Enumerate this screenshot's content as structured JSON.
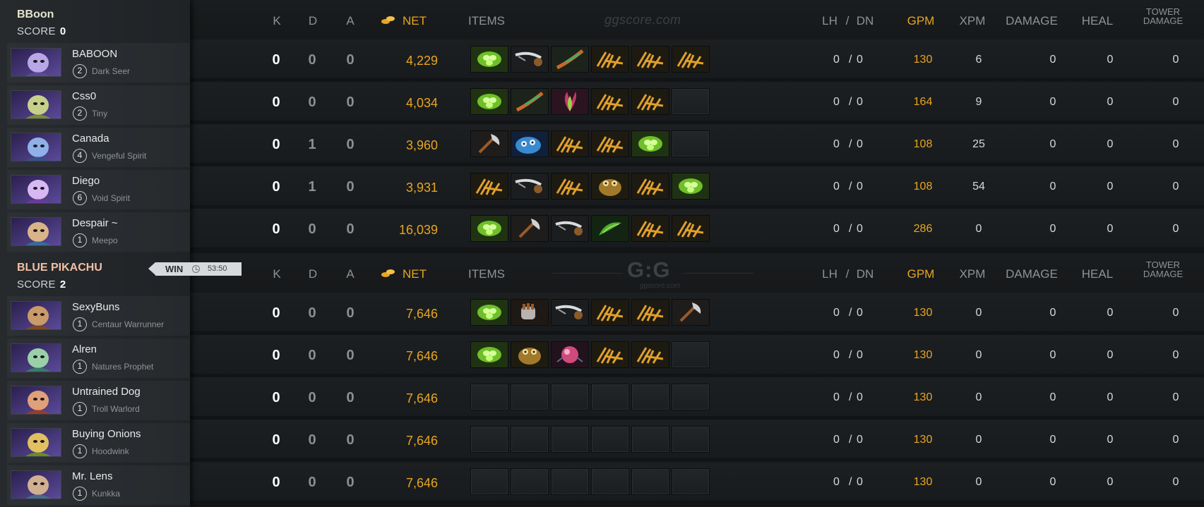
{
  "teams": [
    {
      "name": "BBoon",
      "name_color": "#e5e3cc",
      "score_label": "SCORE",
      "score": "0",
      "header": {
        "k": "K",
        "d": "D",
        "a": "A",
        "net": "NET",
        "items": "ITEMS",
        "lh": "LH",
        "slash": "/",
        "dn": "DN",
        "gpm": "GPM",
        "xpm": "XPM",
        "damage": "DAMAGE",
        "heal": "HEAL",
        "tower_line1": "TOWER",
        "tower_line2": "DAMAGE",
        "watermark": "ggscore.com"
      },
      "players": [
        {
          "name": "BABOON",
          "level": "2",
          "hero": "Dark Seer",
          "portrait": [
            "#5b4a9a",
            "#b9a6e6",
            "#2b1f4d"
          ],
          "k": "0",
          "d": "0",
          "a": "0",
          "net": "4,229",
          "items": [
            "leaf-item-icon",
            "hook-item-icon",
            "branch-item-icon",
            "gloves-item-icon",
            "gloves-item-icon",
            "gloves-item-icon"
          ],
          "lh": "0",
          "dn": "0",
          "gpm": "130",
          "xpm": "6",
          "damage": "0",
          "heal": "0",
          "tower": "0"
        },
        {
          "name": "Css0",
          "level": "2",
          "hero": "Tiny",
          "portrait": [
            "#7a8a3a",
            "#c6d08a",
            "#3e4a22"
          ],
          "k": "0",
          "d": "0",
          "a": "0",
          "net": "4,034",
          "items": [
            "leaf-item-icon",
            "branch-item-icon",
            "plant-item-icon",
            "gloves-item-icon",
            "gloves-item-icon",
            "empty"
          ],
          "lh": "0",
          "dn": "0",
          "gpm": "164",
          "xpm": "9",
          "damage": "0",
          "heal": "0",
          "tower": "0"
        },
        {
          "name": "Canada",
          "level": "4",
          "hero": "Vengeful Spirit",
          "portrait": [
            "#3a4f8a",
            "#8fb0e8",
            "#1b2447"
          ],
          "k": "0",
          "d": "1",
          "a": "0",
          "net": "3,960",
          "items": [
            "axe-item-icon",
            "creature-item-icon",
            "gloves-item-icon",
            "gloves-item-icon",
            "leaf-item-icon",
            "empty"
          ],
          "lh": "0",
          "dn": "0",
          "gpm": "108",
          "xpm": "25",
          "damage": "0",
          "heal": "0",
          "tower": "0"
        },
        {
          "name": "Diego",
          "level": "6",
          "hero": "Void Spirit",
          "portrait": [
            "#6a3a9a",
            "#d7b8f2",
            "#2a1746"
          ],
          "k": "0",
          "d": "1",
          "a": "0",
          "net": "3,931",
          "items": [
            "gloves-item-icon",
            "hook-item-icon",
            "gloves-item-icon",
            "frog-item-icon",
            "gloves-item-icon",
            "leaf-item-icon"
          ],
          "lh": "0",
          "dn": "0",
          "gpm": "108",
          "xpm": "54",
          "damage": "0",
          "heal": "0",
          "tower": "0"
        },
        {
          "name": "Despair ~",
          "level": "1",
          "hero": "Meepo",
          "portrait": [
            "#3a6a9a",
            "#d9b48a",
            "#1e2f44"
          ],
          "k": "0",
          "d": "0",
          "a": "0",
          "net": "16,039",
          "items": [
            "leaf-item-icon",
            "axe-item-icon",
            "hook-item-icon",
            "herb-item-icon",
            "gloves-item-icon",
            "gloves-item-icon"
          ],
          "lh": "0",
          "dn": "0",
          "gpm": "286",
          "xpm": "0",
          "damage": "0",
          "heal": "0",
          "tower": "0"
        }
      ]
    },
    {
      "name": "BLUE PIKACHU",
      "name_color": "#f0c0a4",
      "score_label": "SCORE",
      "score": "2",
      "result": "WIN",
      "duration": "53:50",
      "header": {
        "k": "K",
        "d": "D",
        "a": "A",
        "net": "NET",
        "items": "ITEMS",
        "lh": "LH",
        "slash": "/",
        "dn": "DN",
        "gpm": "GPM",
        "xpm": "XPM",
        "damage": "DAMAGE",
        "heal": "HEAL",
        "tower_line1": "TOWER",
        "tower_line2": "DAMAGE",
        "logo": "G:G",
        "logo_sub": "ggscore.com"
      },
      "players": [
        {
          "name": "SexyBuns",
          "level": "1",
          "hero": "Centaur Warrunner",
          "portrait": [
            "#7a4a2a",
            "#c99a6a",
            "#3b2414"
          ],
          "k": "0",
          "d": "0",
          "a": "0",
          "net": "7,646",
          "items": [
            "leaf-item-icon",
            "gauntlet-item-icon",
            "hook-item-icon",
            "gloves-item-icon",
            "gloves-item-icon",
            "axe-item-icon"
          ],
          "lh": "0",
          "dn": "0",
          "gpm": "130",
          "xpm": "0",
          "damage": "0",
          "heal": "0",
          "tower": "0"
        },
        {
          "name": "Alren",
          "level": "1",
          "hero": "Natures Prophet",
          "portrait": [
            "#3a7a6a",
            "#9ad0a8",
            "#1d3b34"
          ],
          "k": "0",
          "d": "0",
          "a": "0",
          "net": "7,646",
          "items": [
            "leaf-item-icon",
            "frog-item-icon",
            "orb-item-icon",
            "gloves-item-icon",
            "gloves-item-icon",
            "empty"
          ],
          "lh": "0",
          "dn": "0",
          "gpm": "130",
          "xpm": "0",
          "damage": "0",
          "heal": "0",
          "tower": "0"
        },
        {
          "name": "Untrained Dog",
          "level": "1",
          "hero": "Troll Warlord",
          "portrait": [
            "#9a3a2a",
            "#e0a07a",
            "#4a1a12"
          ],
          "k": "0",
          "d": "0",
          "a": "0",
          "net": "7,646",
          "items": [
            "empty",
            "empty",
            "empty",
            "empty",
            "empty",
            "empty"
          ],
          "lh": "0",
          "dn": "0",
          "gpm": "130",
          "xpm": "0",
          "damage": "0",
          "heal": "0",
          "tower": "0"
        },
        {
          "name": "Buying Onions",
          "level": "1",
          "hero": "Hoodwink",
          "portrait": [
            "#6a8a2a",
            "#e0c060",
            "#2e3d12"
          ],
          "k": "0",
          "d": "0",
          "a": "0",
          "net": "7,646",
          "items": [
            "empty",
            "empty",
            "empty",
            "empty",
            "empty",
            "empty"
          ],
          "lh": "0",
          "dn": "0",
          "gpm": "130",
          "xpm": "0",
          "damage": "0",
          "heal": "0",
          "tower": "0"
        },
        {
          "name": "Mr. Lens",
          "level": "1",
          "hero": "Kunkka",
          "portrait": [
            "#4a6a8a",
            "#d0b090",
            "#22303e"
          ],
          "k": "0",
          "d": "0",
          "a": "0",
          "net": "7,646",
          "items": [
            "empty",
            "empty",
            "empty",
            "empty",
            "empty",
            "empty"
          ],
          "lh": "0",
          "dn": "0",
          "gpm": "130",
          "xpm": "0",
          "damage": "0",
          "heal": "0",
          "tower": "0"
        }
      ]
    }
  ]
}
